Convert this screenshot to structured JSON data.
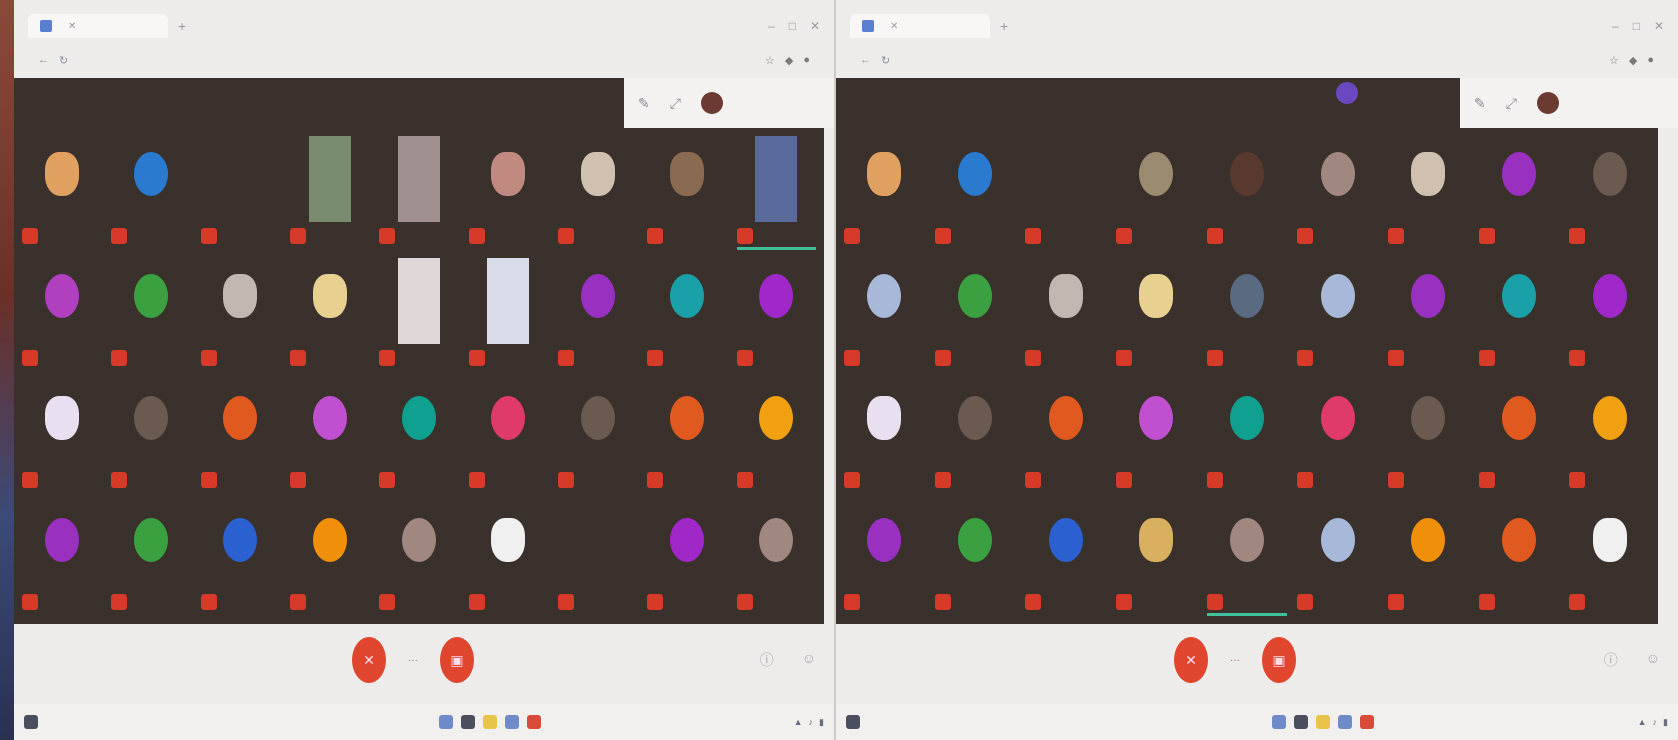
{
  "screens": [
    {
      "tab_title": "",
      "url": "",
      "meeting_label": "",
      "participants": [
        {
          "name": "",
          "color": "#e0a060",
          "kind": "photo"
        },
        {
          "name": "",
          "color": "#2a7ad0",
          "kind": "avatar",
          "initial": ""
        },
        {
          "name": "",
          "color": "#3a302c",
          "kind": "none"
        },
        {
          "name": "",
          "color": "#7a8c70",
          "kind": "video"
        },
        {
          "name": "",
          "color": "#a09090",
          "kind": "video"
        },
        {
          "name": "",
          "color": "#c08a80",
          "kind": "photo"
        },
        {
          "name": "",
          "color": "#d0c0b0",
          "kind": "photo"
        },
        {
          "name": "",
          "color": "#8a6a50",
          "kind": "photo"
        },
        {
          "name": "",
          "color": "#5a6a9a",
          "kind": "video",
          "speaking": true
        },
        {
          "name": "",
          "color": "#b040c0",
          "kind": "avatar",
          "initial": ""
        },
        {
          "name": "",
          "color": "#3aa040",
          "kind": "avatar",
          "initial": ""
        },
        {
          "name": "",
          "color": "#c0b8b0",
          "kind": "photo"
        },
        {
          "name": "",
          "color": "#e8d090",
          "kind": "photo"
        },
        {
          "name": "",
          "color": "#e0d8d8",
          "kind": "video"
        },
        {
          "name": "",
          "color": "#d8dce8",
          "kind": "video"
        },
        {
          "name": "",
          "color": "#9a30c0",
          "kind": "avatar",
          "initial": ""
        },
        {
          "name": "",
          "color": "#1aa0a8",
          "kind": "avatar",
          "initial": ""
        },
        {
          "name": "",
          "color": "#a028c8",
          "kind": "avatar",
          "initial": ""
        },
        {
          "name": "",
          "color": "#e8e0f0",
          "kind": "photo"
        },
        {
          "name": "",
          "color": "#6a5a50",
          "kind": "avatar",
          "initial": ""
        },
        {
          "name": "",
          "color": "#e05a20",
          "kind": "avatar",
          "initial": ""
        },
        {
          "name": "",
          "color": "#c050d0",
          "kind": "avatar",
          "initial": ""
        },
        {
          "name": "",
          "color": "#10a090",
          "kind": "avatar",
          "initial": ""
        },
        {
          "name": "",
          "color": "#e03a6a",
          "kind": "avatar",
          "initial": ""
        },
        {
          "name": "",
          "color": "#6a5a50",
          "kind": "avatar",
          "initial": ""
        },
        {
          "name": "",
          "color": "#e05a20",
          "kind": "avatar",
          "initial": ""
        },
        {
          "name": "",
          "color": "#f0a010",
          "kind": "avatar",
          "initial": ""
        },
        {
          "name": "",
          "color": "#9a30c0",
          "kind": "avatar",
          "initial": ""
        },
        {
          "name": "",
          "color": "#3aa040",
          "kind": "avatar",
          "initial": ""
        },
        {
          "name": "",
          "color": "#2a60d0",
          "kind": "avatar",
          "initial": ""
        },
        {
          "name": "",
          "color": "#f0900a",
          "kind": "avatar",
          "initial": ""
        },
        {
          "name": "",
          "color": "#a08880",
          "kind": "avatar",
          "initial": ""
        },
        {
          "name": "",
          "color": "#f0f0f0",
          "kind": "photo"
        },
        {
          "name": "",
          "color": "#3a302c",
          "kind": "none"
        },
        {
          "name": "",
          "color": "#a028c8",
          "kind": "avatar",
          "initial": ""
        },
        {
          "name": "",
          "color": "#a08880",
          "kind": "avatar",
          "initial": ""
        }
      ]
    },
    {
      "tab_title": "",
      "url": "",
      "meeting_label": "",
      "participants": [
        {
          "name": "",
          "color": "#e0a060",
          "kind": "photo"
        },
        {
          "name": "",
          "color": "#2a7ad0",
          "kind": "avatar",
          "initial": ""
        },
        {
          "name": "",
          "color": "#3a302c",
          "kind": "none"
        },
        {
          "name": "",
          "color": "#9a8a70",
          "kind": "avatar",
          "initial": ""
        },
        {
          "name": "",
          "color": "#5a3a30",
          "kind": "avatar",
          "initial": ""
        },
        {
          "name": "",
          "color": "#a08880",
          "kind": "avatar",
          "initial": ""
        },
        {
          "name": "",
          "color": "#d0c0b0",
          "kind": "photo"
        },
        {
          "name": "",
          "color": "#9a30c0",
          "kind": "avatar",
          "initial": ""
        },
        {
          "name": "",
          "color": "#6a5a50",
          "kind": "avatar",
          "initial": ""
        },
        {
          "name": "",
          "color": "#a8b8d8",
          "kind": "avatar",
          "initial": ""
        },
        {
          "name": "",
          "color": "#3aa040",
          "kind": "avatar",
          "initial": ""
        },
        {
          "name": "",
          "color": "#c0b8b0",
          "kind": "photo"
        },
        {
          "name": "",
          "color": "#e8d090",
          "kind": "photo"
        },
        {
          "name": "",
          "color": "#5a6a80",
          "kind": "avatar",
          "initial": ""
        },
        {
          "name": "",
          "color": "#a8b8d8",
          "kind": "avatar",
          "initial": ""
        },
        {
          "name": "",
          "color": "#9a30c0",
          "kind": "avatar",
          "initial": ""
        },
        {
          "name": "",
          "color": "#1aa0a8",
          "kind": "avatar",
          "initial": ""
        },
        {
          "name": "",
          "color": "#a028c8",
          "kind": "avatar",
          "initial": ""
        },
        {
          "name": "",
          "color": "#e8e0f0",
          "kind": "photo"
        },
        {
          "name": "",
          "color": "#6a5a50",
          "kind": "avatar",
          "initial": ""
        },
        {
          "name": "",
          "color": "#e05a20",
          "kind": "avatar",
          "initial": ""
        },
        {
          "name": "",
          "color": "#c050d0",
          "kind": "avatar",
          "initial": ""
        },
        {
          "name": "",
          "color": "#10a090",
          "kind": "avatar",
          "initial": ""
        },
        {
          "name": "",
          "color": "#e03a6a",
          "kind": "avatar",
          "initial": ""
        },
        {
          "name": "",
          "color": "#6a5a50",
          "kind": "avatar",
          "initial": ""
        },
        {
          "name": "",
          "color": "#e05a20",
          "kind": "avatar",
          "initial": ""
        },
        {
          "name": "",
          "color": "#f0a010",
          "kind": "avatar",
          "initial": ""
        },
        {
          "name": "",
          "color": "#9a30c0",
          "kind": "avatar",
          "initial": ""
        },
        {
          "name": "",
          "color": "#3aa040",
          "kind": "avatar",
          "initial": ""
        },
        {
          "name": "",
          "color": "#2a60d0",
          "kind": "avatar",
          "initial": ""
        },
        {
          "name": "",
          "color": "#d8b060",
          "kind": "photo"
        },
        {
          "name": "",
          "color": "#a08880",
          "kind": "avatar",
          "initial": "",
          "speaking": true
        },
        {
          "name": "",
          "color": "#a8b8d8",
          "kind": "avatar",
          "initial": ""
        },
        {
          "name": "",
          "color": "#f0900a",
          "kind": "avatar",
          "initial": ""
        },
        {
          "name": "",
          "color": "#e05a20",
          "kind": "avatar",
          "initial": ""
        },
        {
          "name": "",
          "color": "#f0f0f0",
          "kind": "photo"
        }
      ]
    }
  ],
  "icons": {
    "mic_off": "mic-off-icon",
    "camera_off": "camera-off-icon",
    "more": "more-icon"
  },
  "colors": {
    "stage": "#3a302c",
    "control_red": "#e0462e",
    "speaking_bar": "#3fbf9a",
    "mic_badge": "#d83a2a"
  }
}
